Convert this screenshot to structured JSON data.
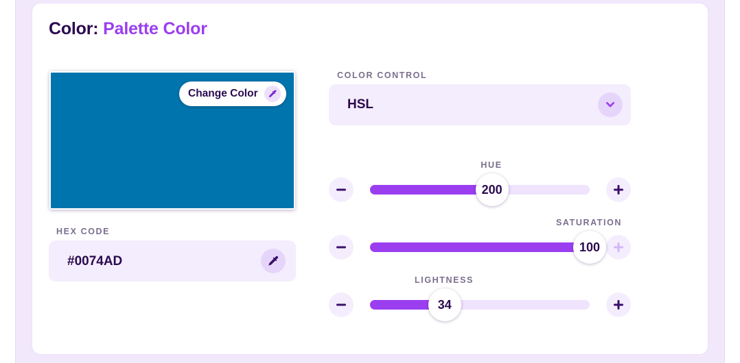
{
  "header": {
    "title_prefix": "Color:",
    "title_accent": "Palette Color"
  },
  "swatch": {
    "color": "#0074AD",
    "change_button_label": "Change Color"
  },
  "hex": {
    "label": "HEX CODE",
    "value": "#0074AD"
  },
  "color_control": {
    "label": "COLOR CONTROL",
    "selected": "HSL"
  },
  "sliders": [
    {
      "name": "hue",
      "label": "HUE",
      "value": "200",
      "fraction": 0.555
    },
    {
      "name": "saturation",
      "label": "SATURATION",
      "value": "100",
      "fraction": 1.0
    },
    {
      "name": "lightness",
      "label": "LIGHTNESS",
      "value": "34",
      "fraction": 0.34
    }
  ],
  "colors": {
    "accent": "#9B3EF0",
    "text_dark": "#2B0A4F",
    "panel": "#F4EDFD"
  }
}
